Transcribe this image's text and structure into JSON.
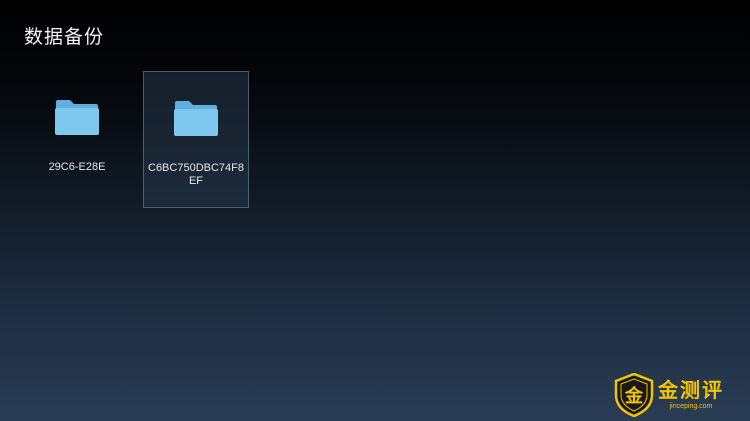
{
  "header": {
    "title": "数据备份"
  },
  "folders": [
    {
      "name": "29C6-E28E",
      "icon": "folder-icon",
      "selected": false
    },
    {
      "name": "C6BC750DBC74F8EF",
      "icon": "folder-icon",
      "selected": true
    }
  ],
  "watermark": {
    "title": "金测评",
    "url": "jinceping.com",
    "badge": "金"
  },
  "colors": {
    "folder_front": "#7ec8ee",
    "folder_back": "#5fb0dd",
    "selection_bg": "#26374b",
    "watermark": "#f5c400"
  }
}
